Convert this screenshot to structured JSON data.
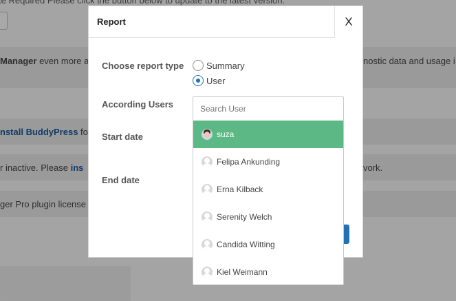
{
  "background": {
    "top_line": "te Required   Please click the button below to update to the latest version.",
    "row1_bold": "Manager",
    "row1_text": " even more a",
    "row1_right": "nostic data and usage i",
    "row2_link": "nstall BuddyPress",
    "row2_text": " fo",
    "row3_text": "r inactive. Please ",
    "row3_link": "ins",
    "row3_right": "vork.",
    "row4_text": "ger Pro plugin license"
  },
  "modal": {
    "title": "Report",
    "close_label": "X",
    "report_type_label": "Choose report type",
    "options": [
      {
        "label": "Summary",
        "checked": false
      },
      {
        "label": "User",
        "checked": true
      }
    ],
    "according_users_label": "According Users",
    "start_date_label": "Start date",
    "end_date_label": "End date"
  },
  "dropdown": {
    "search_placeholder": "Search User",
    "users": [
      {
        "name": "suza",
        "selected": true,
        "avatar": "photo"
      },
      {
        "name": "Felipa Ankunding",
        "selected": false,
        "avatar": "default"
      },
      {
        "name": "Erna Kilback",
        "selected": false,
        "avatar": "default"
      },
      {
        "name": "Serenity Welch",
        "selected": false,
        "avatar": "default"
      },
      {
        "name": "Candida Witting",
        "selected": false,
        "avatar": "default"
      },
      {
        "name": "Kiel Weimann",
        "selected": false,
        "avatar": "default"
      }
    ]
  },
  "colors": {
    "selected_item": "#5cb985",
    "accent": "#2271b1"
  }
}
